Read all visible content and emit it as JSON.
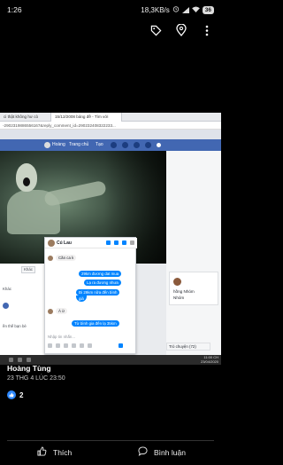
{
  "status_bar": {
    "time": "1:26",
    "network_speed": "18,3KB/s",
    "battery": "36"
  },
  "viewer": {
    "tag_icon": "tag-icon",
    "location_icon": "location-pin-icon",
    "more_icon": "more-vertical-icon"
  },
  "photo": {
    "browser_tabs": [
      "ci thật không hư cò",
      "15/12/2008 bảng đề - Tìm với"
    ],
    "address": "-2902319886556167&reply_comment_id=290232408322233...",
    "fb_nav": {
      "user": "Hoàng",
      "home": "Trang chủ",
      "create": "Tạo"
    },
    "left_post": {
      "other_button": "Khác",
      "like_label": "Khác",
      "comment_prompt": "ền thế bạn bè"
    },
    "chat": {
      "name": "Cú Lau",
      "messages": [
        {
          "dir": "in",
          "text": "Căn ca k"
        },
        {
          "dir": "out",
          "text": "29km đương dat mua"
        },
        {
          "dir": "out",
          "text": "Lạ ra đương nhưa"
        },
        {
          "dir": "out",
          "text": "Đi 29km nữa đến bình"
        },
        {
          "dir": "out",
          "text": "giá"
        },
        {
          "dir": "in",
          "text": "À ừ"
        },
        {
          "dir": "out",
          "text": "Từ bình gia đến lạ 35km"
        }
      ],
      "input_placeholder": "Nhập tin nhắn..."
    },
    "right_panel": {
      "name": "hồng Nhóm",
      "text": "Nhóm",
      "chat_tab": "Trò chuyện (72)"
    },
    "clock": {
      "time": "11:00 CH",
      "date": "23/04/2020"
    }
  },
  "post": {
    "author": "Hoàng Tùng",
    "date": "23 THG 4 LÚC 23:50",
    "like_count": "2",
    "like_label": "Thích",
    "comment_label": "Bình luận"
  },
  "colors": {
    "facebook_blue": "#4267b2",
    "messenger_blue": "#0084ff",
    "like_blue": "#2d88ff"
  }
}
